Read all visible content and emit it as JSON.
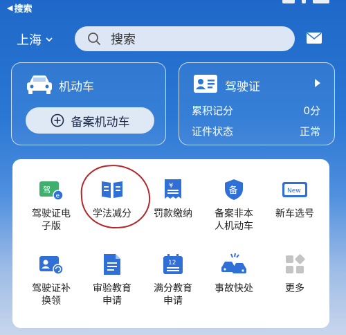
{
  "status_bar": {
    "back_label": "搜索"
  },
  "header": {
    "city": "上海",
    "search_placeholder": "搜索"
  },
  "vehicle_card": {
    "title": "机动车",
    "register_button": "备案机动车"
  },
  "license_card": {
    "title": "驾驶证",
    "points_label": "累积记分",
    "points_value": "0分",
    "status_label": "证件状态",
    "status_value": "正常"
  },
  "services": [
    {
      "label": "驾驶证电子版",
      "icon": "e-license-icon"
    },
    {
      "label": "学法减分",
      "icon": "book-icon"
    },
    {
      "label": "罚款缴纳",
      "icon": "receipt-yuan-icon"
    },
    {
      "label": "备案非本人机动车",
      "icon": "shield-icon"
    },
    {
      "label": "新车选号",
      "icon": "new-plate-icon"
    },
    {
      "label": "驾驶证补换领",
      "icon": "license-renew-icon"
    },
    {
      "label": "审验教育申请",
      "icon": "document-icon"
    },
    {
      "label": "满分教育申请",
      "icon": "calendar-12-icon"
    },
    {
      "label": "事故快处",
      "icon": "car-accident-icon"
    },
    {
      "label": "更多",
      "icon": "grid-more-icon"
    }
  ],
  "colors": {
    "accent": "#2a77d4",
    "annotation": "#b3262b",
    "icon_blue": "#2f6fd6"
  }
}
